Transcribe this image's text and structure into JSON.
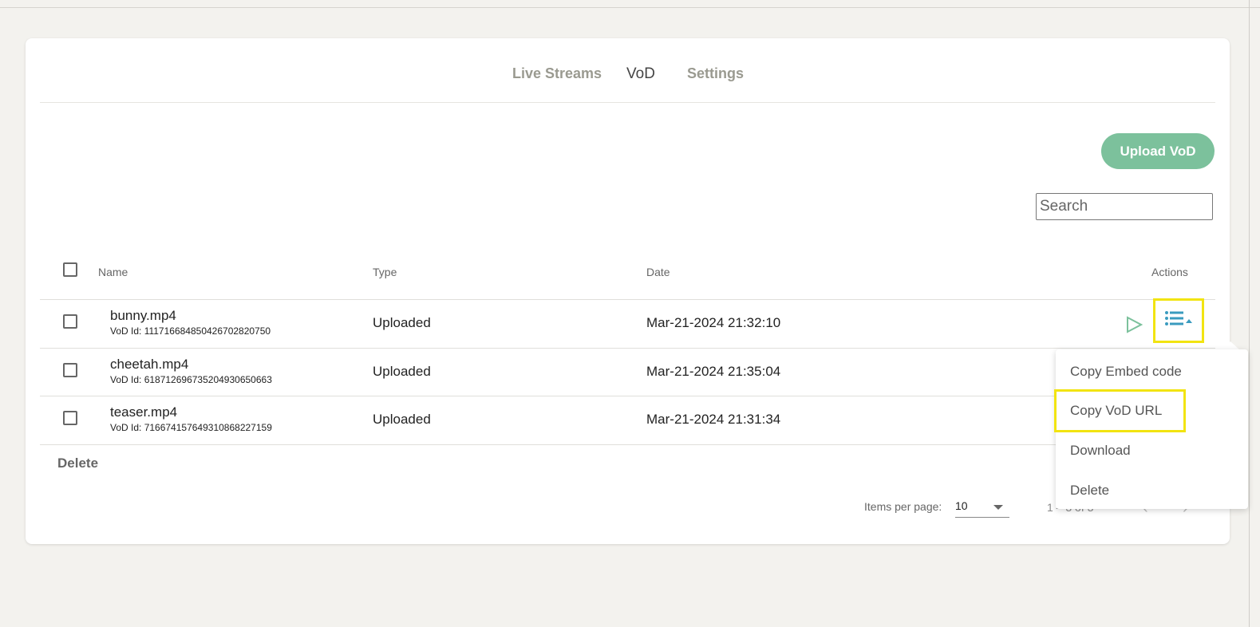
{
  "tabs": [
    {
      "label": "Live Streams"
    },
    {
      "label": "VoD"
    },
    {
      "label": "Settings"
    }
  ],
  "toolbar": {
    "upload_label": "Upload VoD",
    "search_placeholder": "Search"
  },
  "table": {
    "headers": {
      "name": "Name",
      "type": "Type",
      "date": "Date",
      "actions": "Actions"
    },
    "rows": [
      {
        "name": "bunny.mp4",
        "id_label": "VoD Id: 111716684850426702820750",
        "type": "Uploaded",
        "date": "Mar-21-2024 21:32:10"
      },
      {
        "name": "cheetah.mp4",
        "id_label": "VoD Id: 618712696735204930650663",
        "type": "Uploaded",
        "date": "Mar-21-2024 21:35:04"
      },
      {
        "name": "teaser.mp4",
        "id_label": "VoD Id: 716674157649310868227159",
        "type": "Uploaded",
        "date": "Mar-21-2024 21:31:34"
      }
    ]
  },
  "bulk": {
    "delete_label": "Delete"
  },
  "pagination": {
    "items_per_page_label": "Items per page:",
    "items_per_page_value": "10",
    "range_label": "1 – 3 of 3"
  },
  "actions_menu": {
    "items": [
      {
        "label": "Copy Embed code"
      },
      {
        "label": "Copy VoD URL"
      },
      {
        "label": "Download"
      },
      {
        "label": "Delete"
      }
    ]
  },
  "colors": {
    "accent": "#7cc19c",
    "highlight": "#f2e411",
    "action_icon": "#3a9bbf"
  },
  "icons": {
    "play": "play-icon",
    "actions": "list-menu-icon",
    "prev": "chevron-left-icon",
    "next": "chevron-right-icon",
    "dropdown": "caret-down-icon"
  }
}
